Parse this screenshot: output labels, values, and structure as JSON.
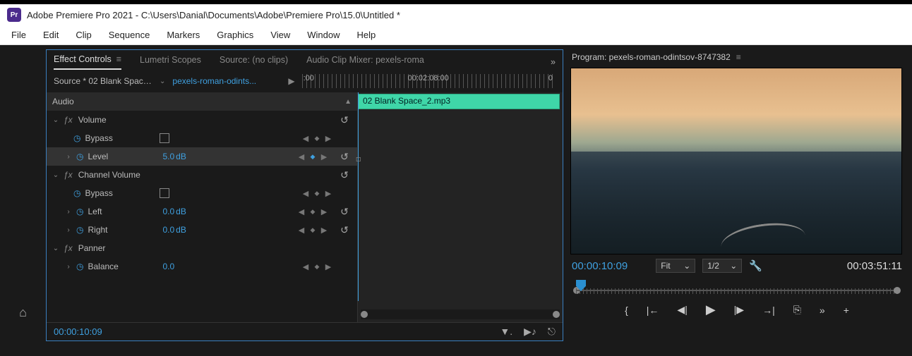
{
  "app": {
    "icon_label": "Pr",
    "title": "Adobe Premiere Pro 2021 - C:\\Users\\Danial\\Documents\\Adobe\\Premiere Pro\\15.0\\Untitled *"
  },
  "menu": {
    "items": [
      "File",
      "Edit",
      "Clip",
      "Sequence",
      "Markers",
      "Graphics",
      "View",
      "Window",
      "Help"
    ]
  },
  "left_panel": {
    "tabs": [
      "Effect Controls",
      "Lumetri Scopes",
      "Source: (no clips)",
      "Audio Clip Mixer: pexels-roma"
    ],
    "source_label": "Source * 02 Blank Space...",
    "sequence_link": "pexels-roman-odints...",
    "timeline": {
      "tc1": ":00",
      "tc2": "00:02:08:00",
      "tc3": "0"
    },
    "clip_name": "02 Blank Space_2.mp3",
    "sections": {
      "audio": "Audio",
      "volume": {
        "label": "Volume",
        "bypass": "Bypass",
        "level_label": "Level",
        "level_value": "5.0",
        "level_unit": "dB"
      },
      "channel_volume": {
        "label": "Channel Volume",
        "bypass": "Bypass",
        "left_label": "Left",
        "left_value": "0.0",
        "left_unit": "dB",
        "right_label": "Right",
        "right_value": "0.0",
        "right_unit": "dB"
      },
      "panner": {
        "label": "Panner",
        "balance_label": "Balance",
        "balance_value": "0.0"
      }
    },
    "bottom_tc": "00:00:10:09"
  },
  "program": {
    "title": "Program: pexels-roman-odintsov-8747382",
    "tc_current": "00:00:10:09",
    "fit_label": "Fit",
    "res_label": "1/2",
    "tc_total": "00:03:51:11"
  }
}
